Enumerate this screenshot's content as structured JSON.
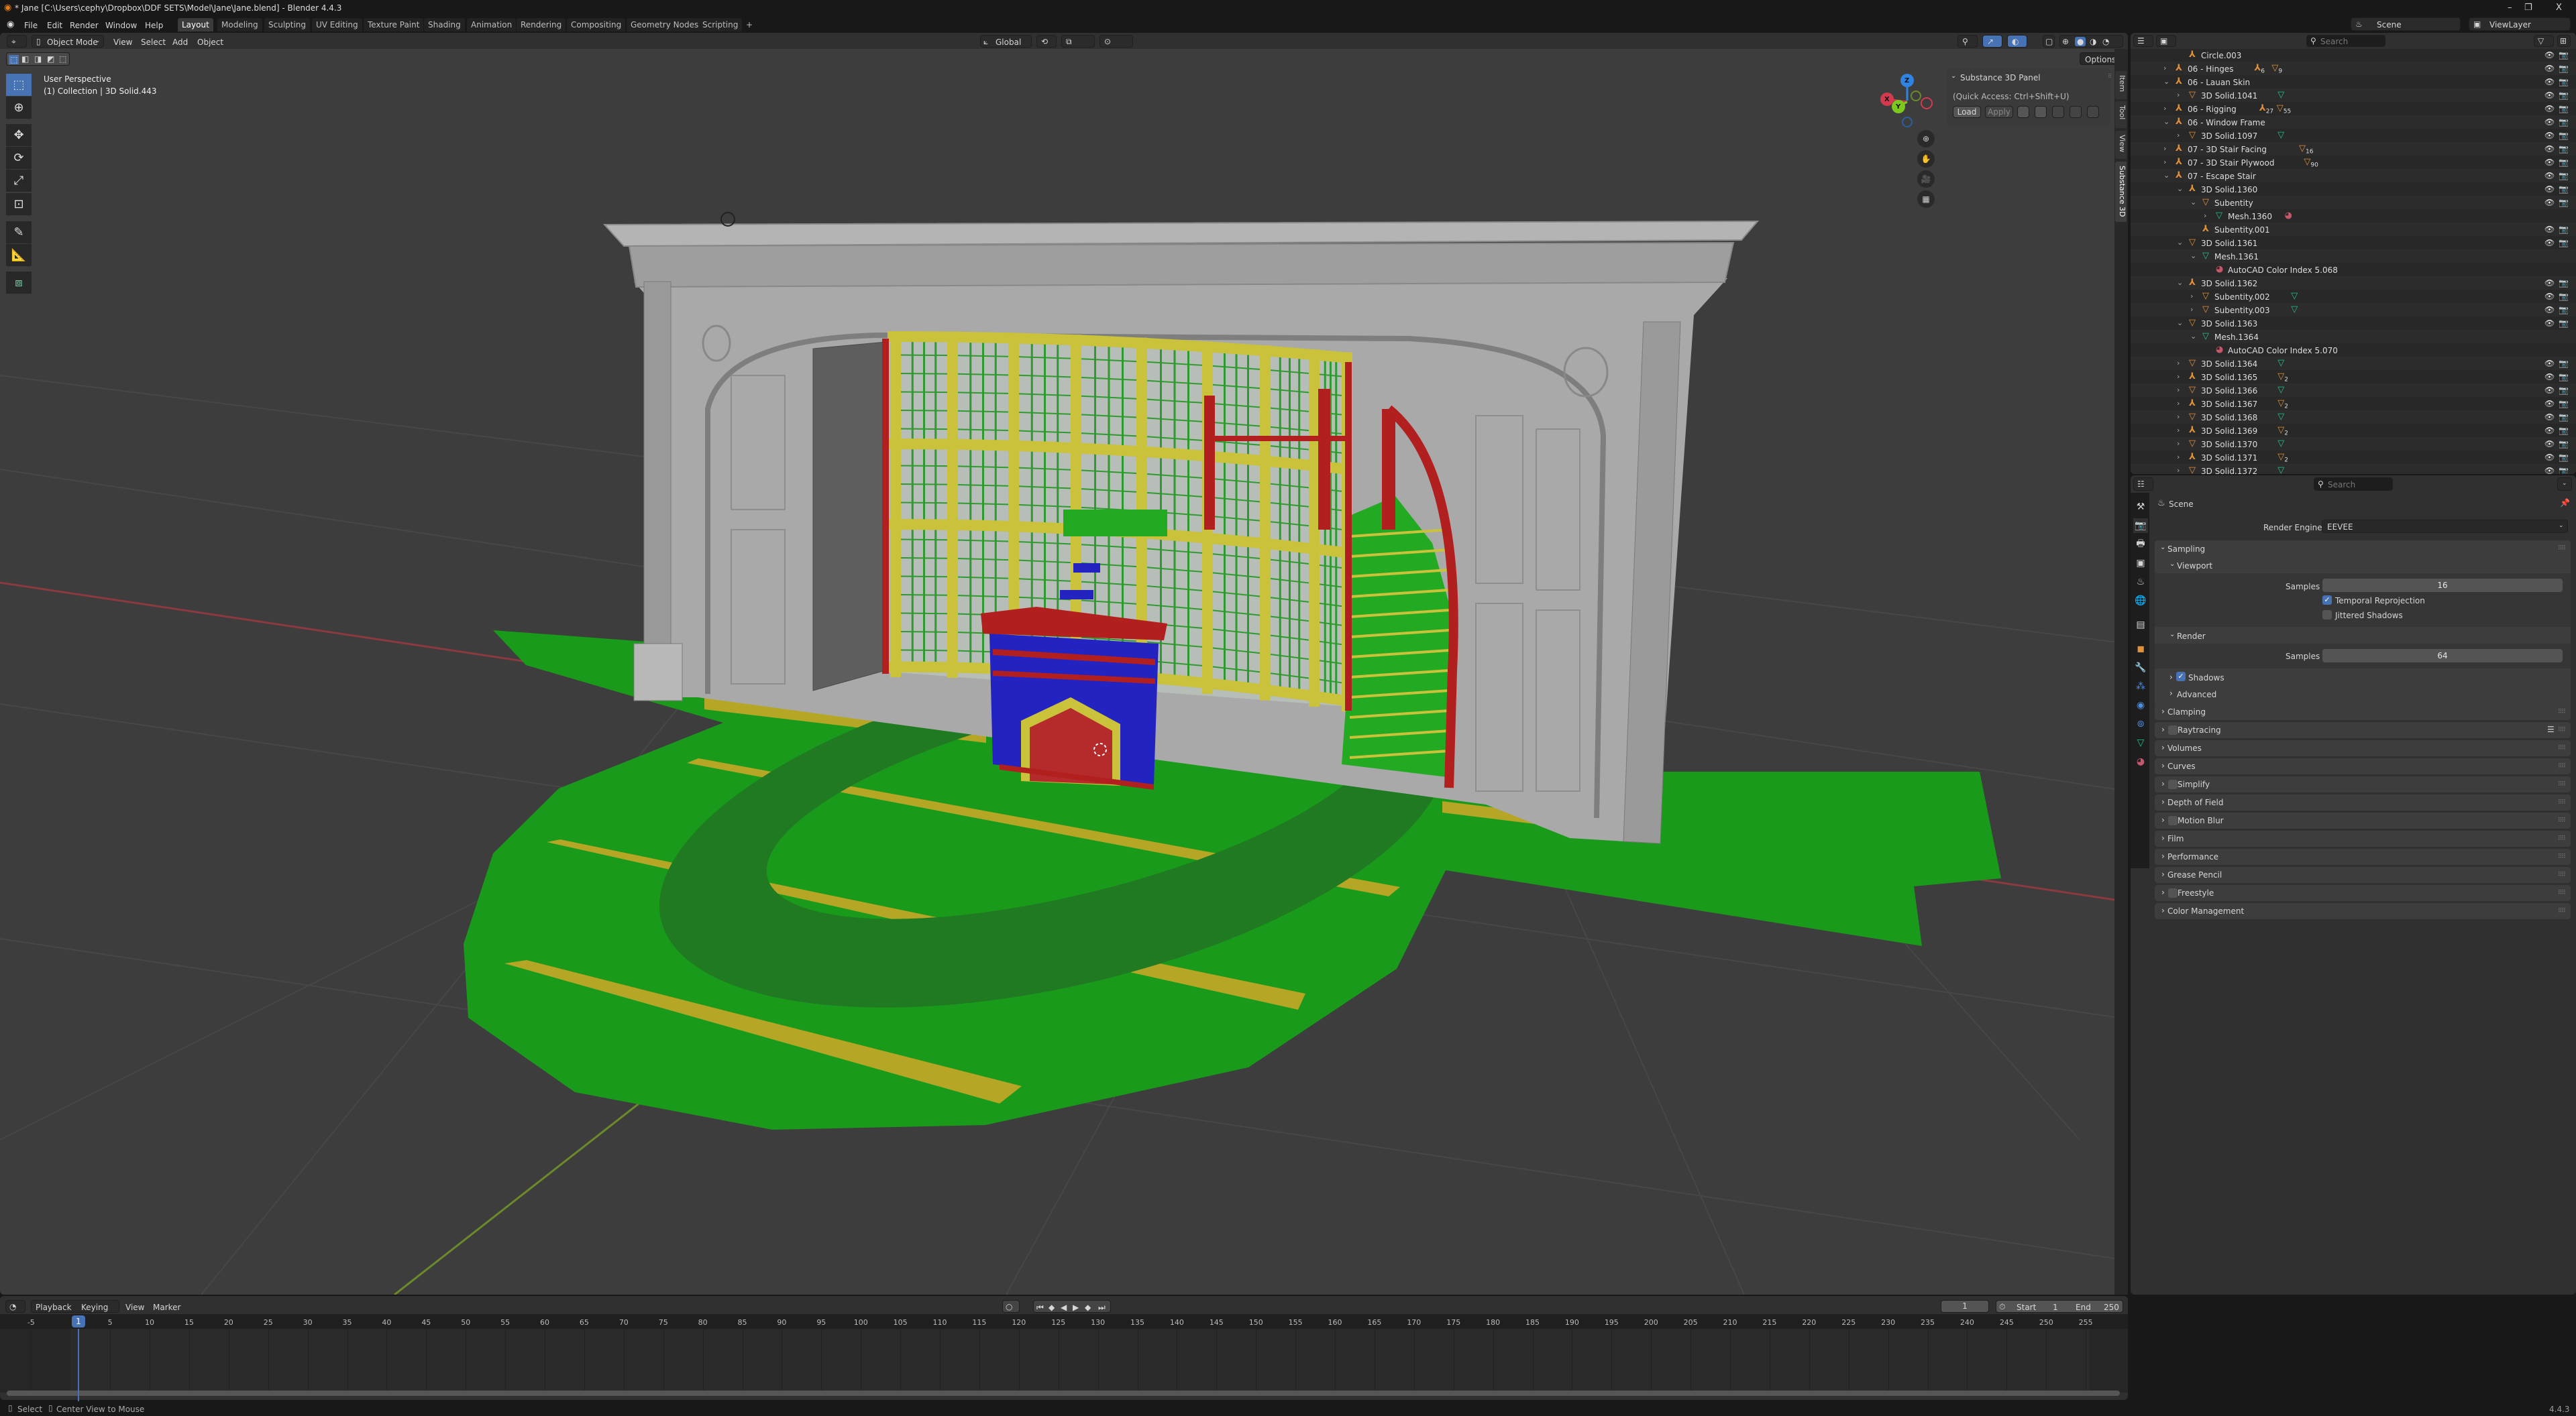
{
  "window": {
    "title": "* Jane [C:\\Users\\cephy\\Dropbox\\DDF SETS\\Model\\Jane\\Jane.blend] - Blender 4.4.3",
    "minimize": "–",
    "maximize": "❐",
    "close": "X"
  },
  "menu": [
    "File",
    "Edit",
    "Render",
    "Window",
    "Help"
  ],
  "workspaces": [
    "Layout",
    "Modeling",
    "Sculpting",
    "UV Editing",
    "Texture Paint",
    "Shading",
    "Animation",
    "Rendering",
    "Compositing",
    "Geometry Nodes",
    "Scripting",
    "+"
  ],
  "scene_selector": {
    "scene": "Scene",
    "view_layer": "ViewLayer"
  },
  "viewport": {
    "mode": "Object Mode",
    "menus": [
      "View",
      "Select",
      "Add",
      "Object"
    ],
    "orientation": "Global",
    "options": "Options",
    "view_name": "User Perspective",
    "active": "(1) Collection | 3D Solid.443",
    "gizmo": {
      "x": "X",
      "y": "Y",
      "z": "Z"
    },
    "side_tabs": [
      "Item",
      "Tool",
      "View",
      "Substance 3D"
    ],
    "substance_panel": {
      "title": "Substance 3D Panel",
      "quick_access": "(Quick Access: Ctrl+Shift+U)",
      "load": "Load",
      "apply": "Apply"
    },
    "colors": {
      "floor": "#1a9a1a",
      "ring": "#1f7a22",
      "strip": "#b5a626",
      "wall": "#a9a9a9",
      "frame": "#c9c23a",
      "fireplace": "#2323c2",
      "accent_red": "#b21f1f"
    }
  },
  "outliner": {
    "search_placeholder": "Search",
    "rows": [
      {
        "label": "Circle.003",
        "depth": 1,
        "expand": "none",
        "icon": "empty",
        "badges": [],
        "vis": true
      },
      {
        "label": "06 - Hinges",
        "depth": 0,
        "expand": "closed",
        "icon": "empty",
        "badges": [
          {
            "icon": "empty",
            "count": "6"
          },
          {
            "icon": "object",
            "count": "9"
          }
        ],
        "vis": true
      },
      {
        "label": "06 - Lauan Skin",
        "depth": 0,
        "expand": "open",
        "icon": "empty",
        "badges": [],
        "vis": true
      },
      {
        "label": "3D Solid.1041",
        "depth": 1,
        "expand": "closed",
        "icon": "object",
        "badges": [
          {
            "icon": "mesh",
            "count": ""
          }
        ],
        "vis": true
      },
      {
        "label": "06 - Rigging",
        "depth": 0,
        "expand": "closed",
        "icon": "empty",
        "badges": [
          {
            "icon": "empty",
            "count": "27"
          },
          {
            "icon": "object",
            "count": "55"
          }
        ],
        "vis": true
      },
      {
        "label": "06 - Window Frame",
        "depth": 0,
        "expand": "open",
        "icon": "empty",
        "badges": [],
        "vis": true
      },
      {
        "label": "3D Solid.1097",
        "depth": 1,
        "expand": "closed",
        "icon": "object",
        "badges": [
          {
            "icon": "mesh",
            "count": ""
          }
        ],
        "vis": true
      },
      {
        "label": "07 - 3D Stair Facing",
        "depth": 0,
        "expand": "closed",
        "icon": "empty",
        "badges": [
          {
            "icon": "object",
            "count": "16"
          }
        ],
        "vis": true
      },
      {
        "label": "07 - 3D Stair Plywood",
        "depth": 0,
        "expand": "closed",
        "icon": "empty",
        "badges": [
          {
            "icon": "object",
            "count": "90"
          }
        ],
        "vis": true
      },
      {
        "label": "07 - Escape Stair",
        "depth": 0,
        "expand": "open",
        "icon": "empty",
        "badges": [],
        "vis": true
      },
      {
        "label": "3D Solid.1360",
        "depth": 1,
        "expand": "open",
        "icon": "empty",
        "badges": [],
        "vis": true
      },
      {
        "label": "Subentity",
        "depth": 2,
        "expand": "open",
        "icon": "object",
        "badges": [],
        "vis": true
      },
      {
        "label": "Mesh.1360",
        "depth": 3,
        "expand": "closed",
        "icon": "mesh",
        "badges": [
          {
            "icon": "material",
            "count": ""
          }
        ],
        "vis": false
      },
      {
        "label": "Subentity.001",
        "depth": 2,
        "expand": "none",
        "icon": "empty",
        "badges": [],
        "vis": true
      },
      {
        "label": "3D Solid.1361",
        "depth": 1,
        "expand": "open",
        "icon": "object",
        "badges": [],
        "vis": true
      },
      {
        "label": "Mesh.1361",
        "depth": 2,
        "expand": "open",
        "icon": "mesh",
        "badges": [],
        "vis": false
      },
      {
        "label": "AutoCAD Color Index 5.068",
        "depth": 3,
        "expand": "none",
        "icon": "material",
        "badges": [],
        "vis": false
      },
      {
        "label": "3D Solid.1362",
        "depth": 1,
        "expand": "open",
        "icon": "empty",
        "badges": [],
        "vis": true
      },
      {
        "label": "Subentity.002",
        "depth": 2,
        "expand": "closed",
        "icon": "object",
        "badges": [
          {
            "icon": "mesh",
            "count": ""
          }
        ],
        "vis": true
      },
      {
        "label": "Subentity.003",
        "depth": 2,
        "expand": "closed",
        "icon": "object",
        "badges": [
          {
            "icon": "mesh",
            "count": ""
          }
        ],
        "vis": true
      },
      {
        "label": "3D Solid.1363",
        "depth": 1,
        "expand": "open",
        "icon": "object",
        "badges": [],
        "vis": true
      },
      {
        "label": "Mesh.1364",
        "depth": 2,
        "expand": "open",
        "icon": "mesh",
        "badges": [],
        "vis": false
      },
      {
        "label": "AutoCAD Color Index 5.070",
        "depth": 3,
        "expand": "none",
        "icon": "material",
        "badges": [],
        "vis": false
      },
      {
        "label": "3D Solid.1364",
        "depth": 1,
        "expand": "closed",
        "icon": "object",
        "badges": [
          {
            "icon": "mesh",
            "count": ""
          }
        ],
        "vis": true
      },
      {
        "label": "3D Solid.1365",
        "depth": 1,
        "expand": "closed",
        "icon": "empty",
        "badges": [
          {
            "icon": "object",
            "count": "2"
          }
        ],
        "vis": true
      },
      {
        "label": "3D Solid.1366",
        "depth": 1,
        "expand": "closed",
        "icon": "object",
        "badges": [
          {
            "icon": "mesh",
            "count": ""
          }
        ],
        "vis": true
      },
      {
        "label": "3D Solid.1367",
        "depth": 1,
        "expand": "closed",
        "icon": "empty",
        "badges": [
          {
            "icon": "object",
            "count": "2"
          }
        ],
        "vis": true
      },
      {
        "label": "3D Solid.1368",
        "depth": 1,
        "expand": "closed",
        "icon": "object",
        "badges": [
          {
            "icon": "mesh",
            "count": ""
          }
        ],
        "vis": true
      },
      {
        "label": "3D Solid.1369",
        "depth": 1,
        "expand": "closed",
        "icon": "empty",
        "badges": [
          {
            "icon": "object",
            "count": "2"
          }
        ],
        "vis": true
      },
      {
        "label": "3D Solid.1370",
        "depth": 1,
        "expand": "closed",
        "icon": "object",
        "badges": [
          {
            "icon": "mesh",
            "count": ""
          }
        ],
        "vis": true
      },
      {
        "label": "3D Solid.1371",
        "depth": 1,
        "expand": "closed",
        "icon": "empty",
        "badges": [
          {
            "icon": "object",
            "count": "2"
          }
        ],
        "vis": true
      },
      {
        "label": "3D Solid.1372",
        "depth": 1,
        "expand": "closed",
        "icon": "object",
        "badges": [
          {
            "icon": "mesh",
            "count": ""
          }
        ],
        "vis": true
      }
    ]
  },
  "properties": {
    "search_placeholder": "Search",
    "context": "Scene",
    "render_engine_label": "Render Engine",
    "render_engine": "EEVEE",
    "sampling": {
      "title": "Sampling",
      "viewport": "Viewport",
      "samples_label": "Samples",
      "viewport_samples": "16",
      "temporal_reprojection": "Temporal Reprojection",
      "temporal_checked": true,
      "jittered_shadows": "Jittered Shadows",
      "jittered_checked": false,
      "render": "Render",
      "render_samples": "64",
      "shadows": "Shadows",
      "shadows_checked": true,
      "advanced": "Advanced"
    },
    "panels": [
      {
        "label": "Clamping",
        "checkbox": false
      },
      {
        "label": "Raytracing",
        "checkbox": true
      },
      {
        "label": "Volumes",
        "checkbox": false
      },
      {
        "label": "Curves",
        "checkbox": false
      },
      {
        "label": "Simplify",
        "checkbox": true
      },
      {
        "label": "Depth of Field",
        "checkbox": false
      },
      {
        "label": "Motion Blur",
        "checkbox": true
      },
      {
        "label": "Film",
        "checkbox": false
      },
      {
        "label": "Performance",
        "checkbox": false
      },
      {
        "label": "Grease Pencil",
        "checkbox": false
      },
      {
        "label": "Freestyle",
        "checkbox": true
      },
      {
        "label": "Color Management",
        "checkbox": false
      }
    ]
  },
  "timeline": {
    "menus": [
      "Playback",
      "Keying",
      "View",
      "Marker"
    ],
    "current_frame": "1",
    "start_label": "Start",
    "start": "1",
    "end_label": "End",
    "end": "250",
    "ruler_labels": [
      -5,
      5,
      10,
      15,
      20,
      25,
      30,
      35,
      40,
      45,
      50,
      55,
      60,
      65,
      70,
      75,
      80,
      85,
      90,
      95,
      100,
      105,
      110,
      115,
      120,
      125,
      130,
      135,
      140,
      145,
      150,
      155,
      160,
      165,
      170,
      175,
      180,
      185,
      190,
      195,
      200,
      205,
      210,
      215,
      220,
      225,
      230,
      235,
      240,
      245,
      250,
      255
    ]
  },
  "statusbar": {
    "select": "Select",
    "center_view": "Center View to Mouse",
    "version": "4.4.3"
  }
}
